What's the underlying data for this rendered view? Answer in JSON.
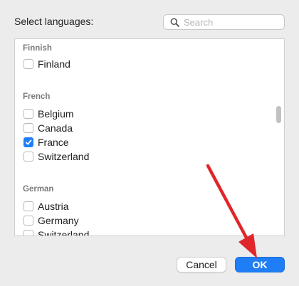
{
  "dialog": {
    "prompt_label": "Select languages:",
    "search": {
      "placeholder": "Search",
      "value": ""
    }
  },
  "groups": [
    {
      "header": "Finnish",
      "items": [
        {
          "label": "Finland",
          "checked": false
        }
      ]
    },
    {
      "header": "French",
      "items": [
        {
          "label": "Belgium",
          "checked": false
        },
        {
          "label": "Canada",
          "checked": false
        },
        {
          "label": "France",
          "checked": true
        },
        {
          "label": "Switzerland",
          "checked": false
        }
      ]
    },
    {
      "header": "German",
      "items": [
        {
          "label": "Austria",
          "checked": false
        },
        {
          "label": "Germany",
          "checked": false
        },
        {
          "label": "Switzerland",
          "checked": false
        }
      ]
    }
  ],
  "buttons": {
    "cancel_label": "Cancel",
    "ok_label": "OK"
  },
  "colors": {
    "accent": "#1f7ef5",
    "annotation_arrow": "#e0262b"
  },
  "icons": {
    "search": "search-icon",
    "check": "checkmark-icon",
    "arrow": "arrow-icon"
  }
}
